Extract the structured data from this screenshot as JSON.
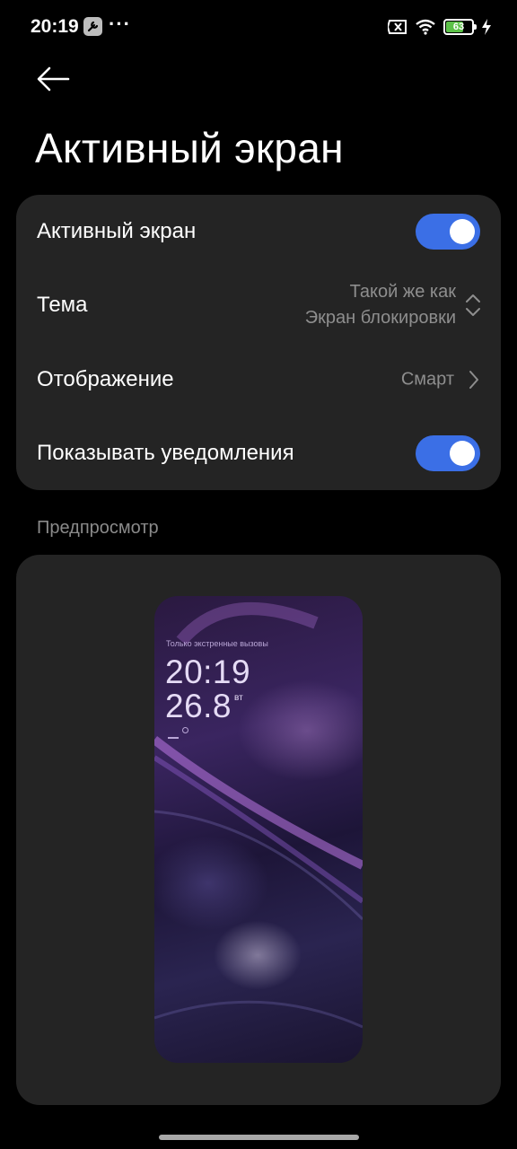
{
  "status_bar": {
    "time": "20:19",
    "more": "···",
    "battery_level": "63",
    "battery_color": "#5cc148",
    "icons": [
      "wrench-icon",
      "no-sim-icon",
      "wifi-icon",
      "battery-icon",
      "charging-bolt-icon"
    ]
  },
  "header": {
    "back_icon": "arrow-left-icon",
    "title": "Активный экран"
  },
  "settings": {
    "always_on": {
      "label": "Активный экран",
      "enabled": true
    },
    "theme": {
      "label": "Тема",
      "value_line1": "Такой же как",
      "value_line2": "Экран блокировки"
    },
    "display": {
      "label": "Отображение",
      "value": "Смарт"
    },
    "notifications": {
      "label": "Показывать уведомления",
      "enabled": true
    },
    "accent_color": "#3b6fe6"
  },
  "preview": {
    "section_label": "Предпросмотр",
    "emergency_text": "Только экстренные вызовы",
    "time": "20:19",
    "date": "26.8",
    "weekday": "вт"
  }
}
